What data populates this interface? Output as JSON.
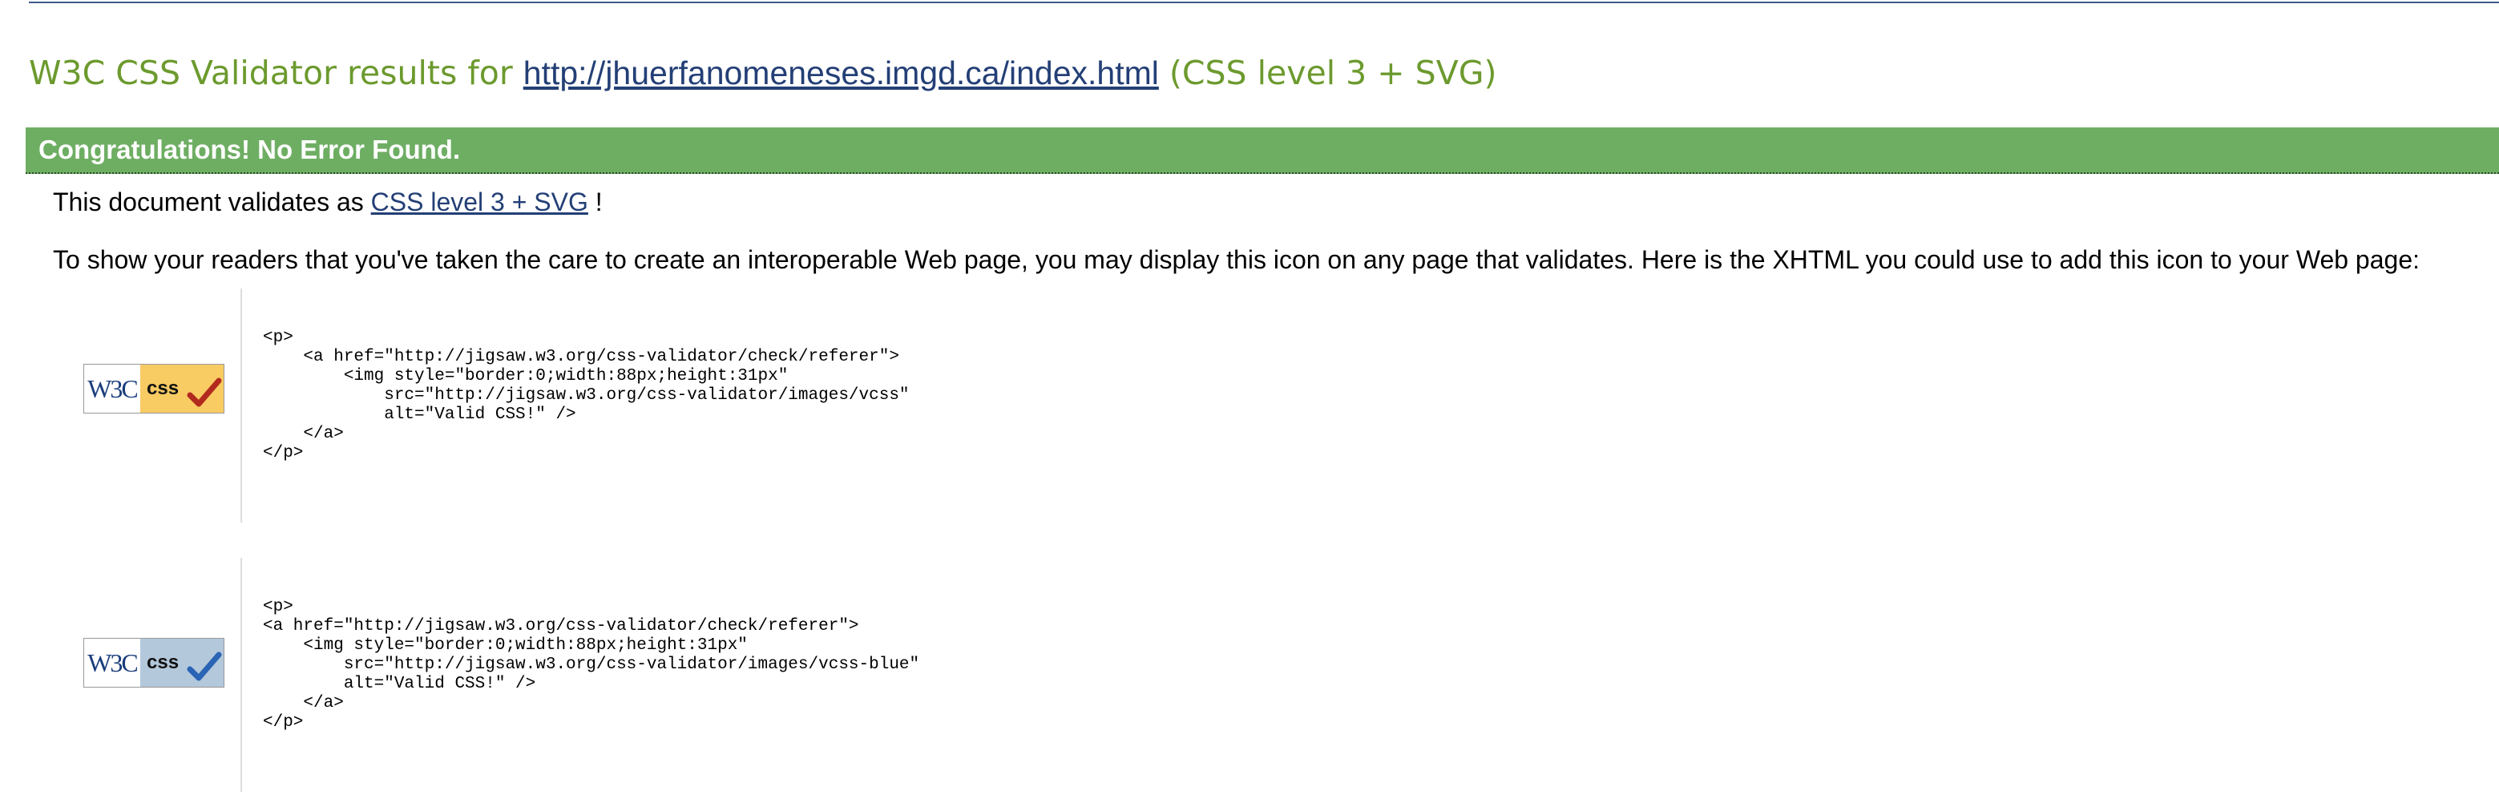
{
  "header": {
    "title_prefix": "W3C CSS Validator results for ",
    "url": "http://jhuerfanomeneses.imgd.ca/index.html",
    "title_suffix": " (CSS level 3 + SVG)"
  },
  "banner": {
    "text": "Congratulations! No Error Found."
  },
  "validates": {
    "prefix": "This document validates as ",
    "link": "CSS level 3 + SVG",
    "suffix": " !"
  },
  "info": {
    "text": "To show your readers that you've taken the care to create an interoperable Web page, you may display this icon on any page that validates. Here is the XHTML you could use to add this icon to your Web page:"
  },
  "badges": [
    {
      "logo_text": "W3C",
      "css_text": "css",
      "bg_color": "#f8cb63",
      "check_color": "#b22a1e",
      "code": "<p>\n    <a href=\"http://jigsaw.w3.org/css-validator/check/referer\">\n        <img style=\"border:0;width:88px;height:31px\"\n            src=\"http://jigsaw.w3.org/css-validator/images/vcss\"\n            alt=\"Valid CSS!\" />\n    </a>\n</p>"
    },
    {
      "logo_text": "W3C",
      "css_text": "css",
      "bg_color": "#b4c8dc",
      "check_color": "#2a64b4",
      "code": "<p>\n<a href=\"http://jigsaw.w3.org/css-validator/check/referer\">\n    <img style=\"border:0;width:88px;height:31px\"\n        src=\"http://jigsaw.w3.org/css-validator/images/vcss-blue\"\n        alt=\"Valid CSS!\" />\n    </a>\n</p>"
    }
  ]
}
